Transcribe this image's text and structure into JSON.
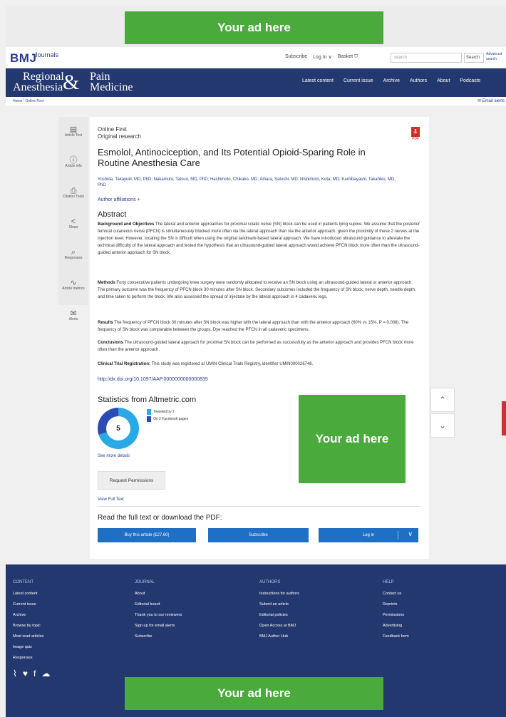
{
  "ads": {
    "top": "Your ad here",
    "middle": "Your ad here",
    "bottom": "Your ad here"
  },
  "topbar": {
    "logo": "BMJ",
    "logo_sub": "Journals",
    "subscribe": "Subscribe",
    "login": "Log In",
    "basket": "Basket",
    "search_placeholder": "search",
    "search_btn": "Search",
    "advanced": "Advanced search"
  },
  "journal": {
    "line1a": "Regional",
    "amp": "&",
    "line1b": "Pain",
    "line2a": "Anesthesia",
    "line2b": "Medicine"
  },
  "nav": [
    "Latest content",
    "Current issue",
    "Archive",
    "Authors",
    "About",
    "Podcasts"
  ],
  "breadcrumb": [
    "Home",
    "Online First"
  ],
  "email_alerts": "Email alerts",
  "sidebar": [
    {
      "label": "Article Text",
      "icon": "document-icon"
    },
    {
      "label": "Article info",
      "icon": "info-icon"
    },
    {
      "label": "Citation Tools",
      "icon": "citation-icon"
    },
    {
      "label": "Share",
      "icon": "share-icon"
    },
    {
      "label": "Responses",
      "icon": "responses-icon"
    },
    {
      "label": "Article metrics",
      "icon": "metrics-icon"
    },
    {
      "label": "Alerts",
      "icon": "mail-icon"
    }
  ],
  "article": {
    "status": "Online First",
    "type": "Original research",
    "pdf": "PDF",
    "title": "Esmolol, Antinociception, and Its Potential Opioid-Sparing Role in Routine Anesthesia Care",
    "authors": "Yoshida, Takayuki, MD, PhD; Nakamoto, Tatsuo, MD, PhD; Hashimoto, Chikako, MD; Aihara, Satoshi, MD; Nishimoto, Kota, MD; Kamibayashi, Takahiko, MD, PhD",
    "affiliations": "Author affiliations +",
    "abstract_heading": "Abstract",
    "background_label": "Background and Objectives",
    "background": "The lateral and anterior approaches for proximal sciatic nerve (SN) block can be used in patients lying supine. We assume that the posterior femoral cutaneous nerve (PFCN) is simultaneously blocked more often via the lateral approach than via the anterior approach, given the proximity of these 2 nerves at the injection level. However, locating the SN is difficult when using the original landmark-based lateral approach. We have introduced ultrasound guidance to alleviate the technical difficulty of the lateral approach and tested the hypothesis that an ultrasound-guided lateral approach would achieve PFCN block more often than the ultrasound-guided anterior approach for SN block.",
    "methods_label": "Methods",
    "methods": "Forty consecutive patients undergoing knee surgery were randomly allocated to receive an SN block using an ultrasound-guided lateral or anterior approach. The primary outcome was the frequency of PFCN block 30 minutes after SN block. Secondary outcomes included the frequency of SN block, nerve depth, needle depth, and time taken to perform the block. We also assessed the spread of injectate by the lateral approach in 4 cadaveric legs.",
    "results_label": "Results",
    "results": "The frequency of PFCN block 30 minutes after SN block was higher with the lateral approach than with the anterior approach (60% vs 15%, P = 0.008). The frequency of SN block was comparable between the groups. Dye reached the PFCN in all cadaveric specimens.",
    "conclusions_label": "Conclusions",
    "conclusions": "The ultrasound-guided lateral approach for proximal SN block can be performed as successfully as the anterior approach and provides PFCN block more often than the anterior approach.",
    "trial_label": "Clinical Trial Registration:",
    "trial": "This study was registered at UMIN Clinical Trials Registry, identifier UMIN000026748.",
    "doi": "http://dx.doi.org/10.1097/AAP.0000000000000835"
  },
  "altmetric": {
    "heading": "Statistics from Altmetric.com",
    "score": "5",
    "tweeted": "Tweeted by 7",
    "facebook": "On 2 Facebook pages",
    "see_more": "See more details",
    "colors": {
      "twitter": "#29a9e6",
      "facebook": "#2a4db5"
    }
  },
  "actions": {
    "request_permissions": "Request Permissions",
    "view_full_text": "View Full Text",
    "read_heading": "Read the full text or download the PDF:",
    "buy": "Buy this article (£27.60)",
    "subscribe": "Subscribe",
    "login": "Log in"
  },
  "footer": {
    "content": {
      "heading": "CONTENT",
      "items": [
        "Latest content",
        "Current issue",
        "Archive",
        "Browse by topic",
        "Most read articles",
        "Image quiz",
        "Responses"
      ]
    },
    "journal": {
      "heading": "JOURNAL",
      "items": [
        "About",
        "Editorial board",
        "Thank you to our reviewers",
        "Sign up for email alerts",
        "Subscribe"
      ]
    },
    "authors": {
      "heading": "AUTHORS",
      "items": [
        "Instructions for authors",
        "Submit an article",
        "Editorial policies",
        "Open Access at BMJ",
        "BMJ Author Hub"
      ]
    },
    "help": {
      "heading": "HELP",
      "items": [
        "Contact us",
        "Reprints",
        "Permissions",
        "Advertising",
        "Feedback form"
      ]
    }
  },
  "colors": {
    "brand_navy": "#23386f",
    "link_blue": "#2a3c8f",
    "button_blue": "#1f6fc4",
    "ad_green": "#4aaa3c",
    "pdf_red": "#d0302a"
  }
}
